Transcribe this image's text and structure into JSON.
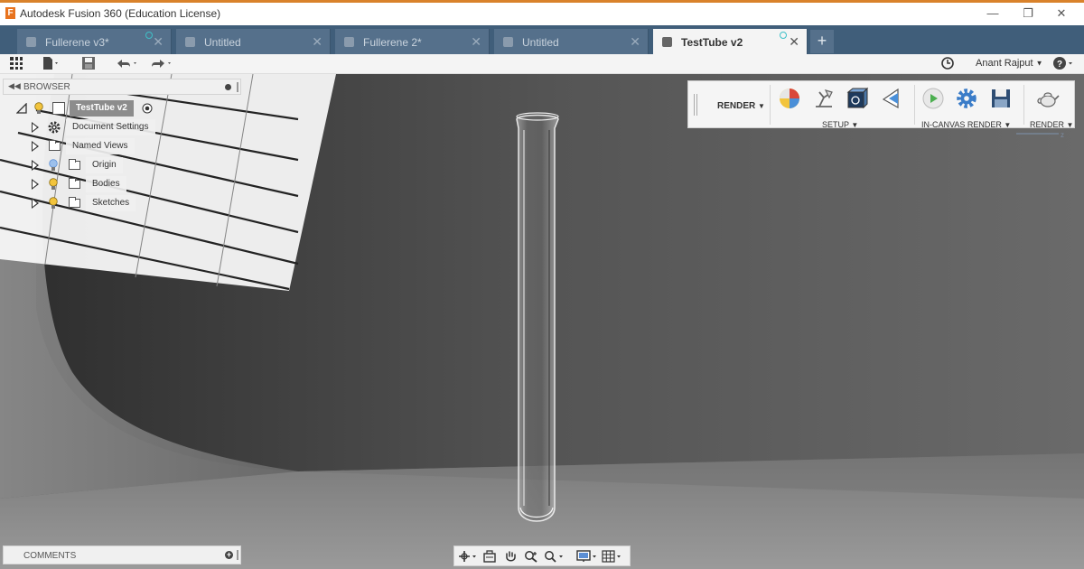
{
  "window": {
    "title": "Autodesk Fusion 360 (Education License)",
    "logo_letter": "F"
  },
  "tabs": [
    {
      "label": "Fullerene v3*",
      "icon": "cube-icon",
      "sync": true
    },
    {
      "label": "Untitled",
      "icon": "cube-icon",
      "sync": false
    },
    {
      "label": "Fullerene 2*",
      "icon": "cube-icon",
      "sync": false
    },
    {
      "label": "Untitled",
      "icon": "cube-icon",
      "sync": false
    },
    {
      "label": "TestTube v2",
      "icon": "cube-icon",
      "sync": true,
      "active": true
    }
  ],
  "appbar": {
    "user": "Anant Rajput",
    "icons": [
      "grid-icon",
      "file-icon",
      "save-icon",
      "undo-icon",
      "redo-icon",
      "clock-icon",
      "help-icon"
    ]
  },
  "browser": {
    "title": "BROWSER",
    "root": "TestTube v2",
    "items": [
      {
        "label": "Document Settings",
        "icon": "gear-icon",
        "bulb": false
      },
      {
        "label": "Named Views",
        "icon": "folder-icon",
        "bulb": false
      },
      {
        "label": "Origin",
        "icon": "folder-icon",
        "bulb": true,
        "bulb_color": "#5b8fd6"
      },
      {
        "label": "Bodies",
        "icon": "folder-icon",
        "bulb": true,
        "bulb_color": "#f2c43d"
      },
      {
        "label": "Sketches",
        "icon": "folder-icon",
        "bulb": true,
        "bulb_color": "#f2c43d"
      }
    ]
  },
  "toolbar": {
    "workspace": "RENDER",
    "groups": [
      {
        "label": "SETUP",
        "icons": [
          "appearance-icon",
          "scene-settings-icon",
          "texture-map-icon",
          "decal-icon"
        ]
      },
      {
        "label": "IN-CANVAS RENDER",
        "icons": [
          "in-canvas-render-icon",
          "render-settings-icon",
          "capture-image-icon"
        ]
      },
      {
        "label": "RENDER",
        "icons": [
          "teapot-render-icon"
        ]
      }
    ]
  },
  "comments": {
    "title": "COMMENTS"
  },
  "navbar": {
    "icons": [
      "orbit-icon",
      "look-at-icon",
      "pan-icon",
      "zoom-icon",
      "fit-icon",
      "display-settings-icon",
      "grid-settings-icon"
    ]
  },
  "colors": {
    "tabbar": "#405e7a",
    "accent_orange": "#e8731d",
    "viewport": "#5a5a5a"
  }
}
